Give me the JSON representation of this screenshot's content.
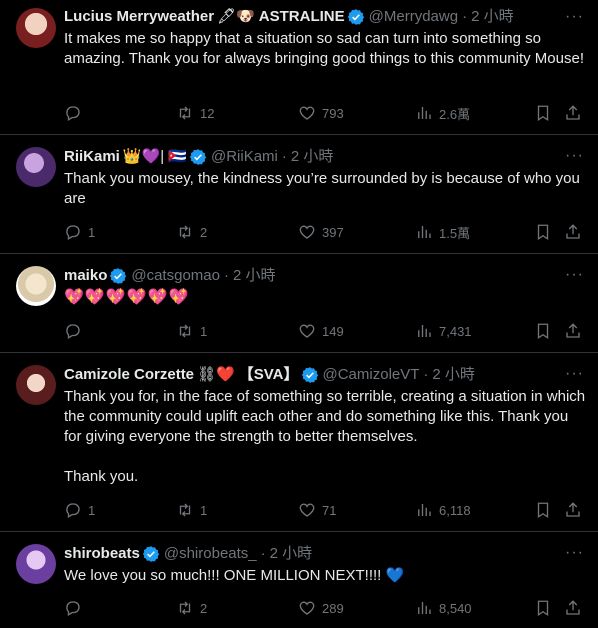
{
  "tweets": [
    {
      "name": "Lucius Merryweather",
      "name_emoji": "🖋🐶",
      "name_suffix": "ASTRALINE",
      "handle": "@Merrydawg",
      "time": "2 小時",
      "text": "It makes me so happy that a situation so sad can turn into something so amazing. Thank you for always bringing good things to this community Mouse!",
      "replies": "",
      "retweets": "12",
      "likes": "793",
      "views": "2.6萬",
      "avatar_color": "#7a1f1f"
    },
    {
      "name": "RiiKami",
      "name_emoji": "👑💜| 🇨🇺",
      "name_suffix": "",
      "handle": "@RiiKami",
      "time": "2 小時",
      "text": "Thank you mousey, the kindness you’re surrounded by is because of who you are",
      "replies": "1",
      "retweets": "2",
      "likes": "397",
      "views": "1.5萬",
      "avatar_color": "#4b2a6b"
    },
    {
      "name": "maiko",
      "name_emoji": "",
      "name_suffix": "",
      "handle": "@catsgomao",
      "time": "2 小時",
      "text": "💖💖💖💖💖💖",
      "replies": "",
      "retweets": "1",
      "likes": "149",
      "views": "7,431",
      "avatar_color": "#d9c9a8"
    },
    {
      "name": "Camizole Corzette",
      "name_emoji": "⛓❤️",
      "name_suffix": "【SVA】",
      "handle": "@CamizoleVT",
      "time": "2 小時",
      "text": "Thank you for, in the face of something so terrible, creating a situation in which the community could uplift each other and do something like this. Thank you for giving everyone the strength to better themselves.\n\nThank you.",
      "replies": "1",
      "retweets": "1",
      "likes": "71",
      "views": "6,118",
      "avatar_color": "#5a1d1d"
    },
    {
      "name": "shirobeats",
      "name_emoji": "",
      "name_suffix": "",
      "handle": "@shirobeats_",
      "time": "2 小時",
      "text": "We love you so much!!! ONE MILLION NEXT!!!! 💙",
      "replies": "",
      "retweets": "2",
      "likes": "289",
      "views": "8,540",
      "avatar_color": "#6b3fa0"
    }
  ],
  "colors": {
    "accent": "#1d9bf0",
    "muted": "#71767b",
    "divider": "#2f3336"
  },
  "icons": [
    "reply-icon",
    "retweet-icon",
    "like-icon",
    "views-icon",
    "bookmark-icon",
    "share-icon",
    "verified-icon",
    "more-icon"
  ]
}
